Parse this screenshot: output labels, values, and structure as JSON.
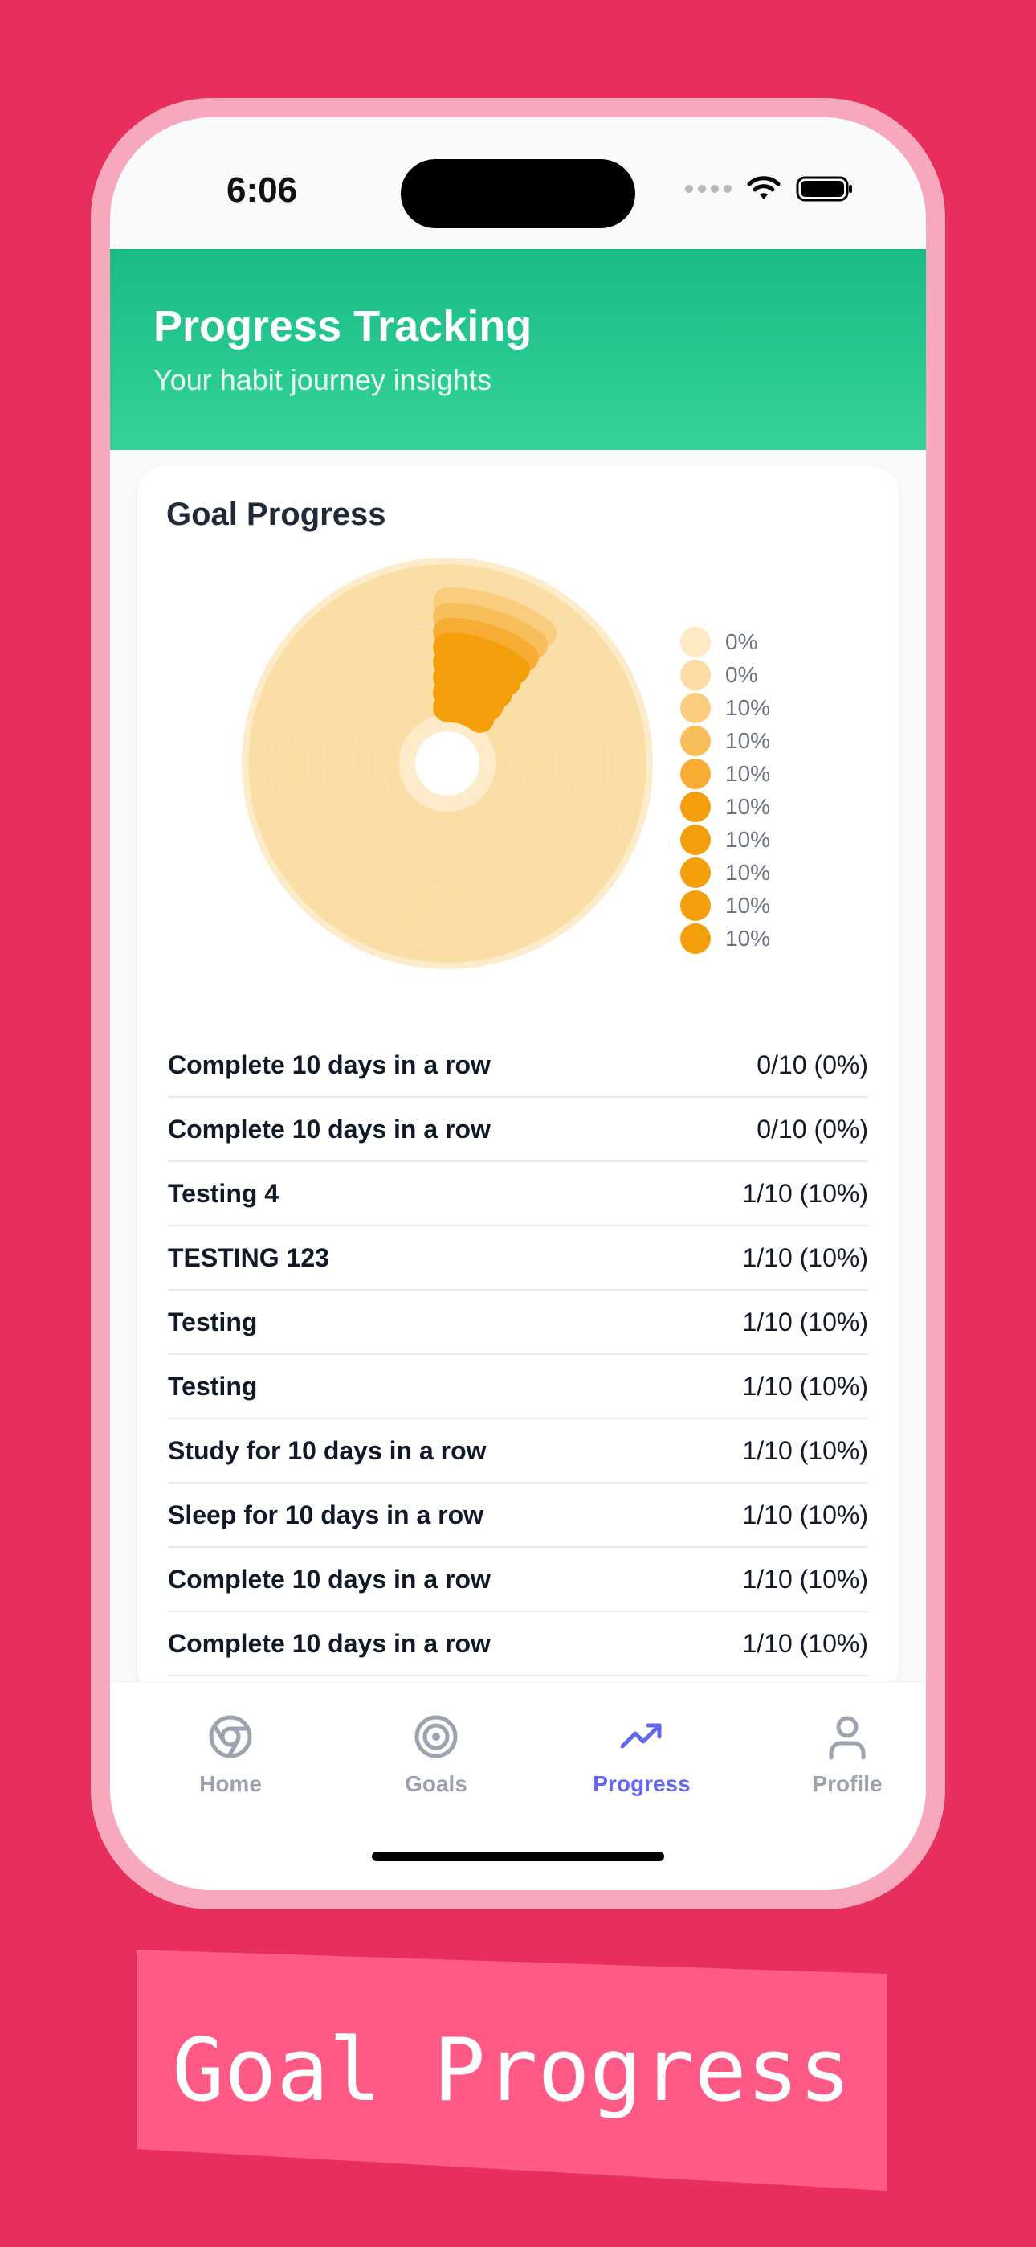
{
  "status_bar": {
    "time": "6:06"
  },
  "header": {
    "title": "Progress Tracking",
    "subtitle": "Your habit journey insights"
  },
  "card": {
    "title": "Goal Progress"
  },
  "chart_data": {
    "type": "pie",
    "title": "Goal Progress",
    "legend_position": "right",
    "series": [
      {
        "label": "0%",
        "value": 0,
        "color": "#fde9c4"
      },
      {
        "label": "0%",
        "value": 0,
        "color": "#fcdca4"
      },
      {
        "label": "10%",
        "value": 10,
        "color": "#f9cd7d"
      },
      {
        "label": "10%",
        "value": 10,
        "color": "#f8be5a"
      },
      {
        "label": "10%",
        "value": 10,
        "color": "#f7ad34"
      },
      {
        "label": "10%",
        "value": 10,
        "color": "#f59e0b"
      },
      {
        "label": "10%",
        "value": 10,
        "color": "#f59e0b"
      },
      {
        "label": "10%",
        "value": 10,
        "color": "#f59e0b"
      },
      {
        "label": "10%",
        "value": 10,
        "color": "#f59e0b"
      },
      {
        "label": "10%",
        "value": 10,
        "color": "#f59e0b"
      }
    ]
  },
  "goals": [
    {
      "name": "Complete 10 days in a row",
      "value": "0/10 (0%)"
    },
    {
      "name": "Complete 10 days in a row",
      "value": "0/10 (0%)"
    },
    {
      "name": "Testing 4",
      "value": "1/10 (10%)"
    },
    {
      "name": "TESTING 123",
      "value": "1/10 (10%)"
    },
    {
      "name": "Testing",
      "value": "1/10 (10%)"
    },
    {
      "name": "Testing",
      "value": "1/10 (10%)"
    },
    {
      "name": "Study for 10 days in a row",
      "value": "1/10 (10%)"
    },
    {
      "name": "Sleep for 10 days in a row",
      "value": "1/10 (10%)"
    },
    {
      "name": "Complete 10 days in a row",
      "value": "1/10 (10%)"
    },
    {
      "name": "Complete 10 days in a row",
      "value": "1/10 (10%)"
    }
  ],
  "tabs": [
    {
      "label": "Home",
      "icon": "chrome-icon",
      "active": false
    },
    {
      "label": "Goals",
      "icon": "target-icon",
      "active": false
    },
    {
      "label": "Progress",
      "icon": "trending-up-icon",
      "active": true
    },
    {
      "label": "Profile",
      "icon": "user-icon",
      "active": false
    }
  ],
  "banner": {
    "text": "Goal Progress",
    "color": "#ff5a86"
  },
  "colors": {
    "background": "#e82e5c",
    "frame": "#f7a8bd",
    "header": "#1cc38a",
    "accent": "#6366f1",
    "chart": "#f59e0b"
  }
}
